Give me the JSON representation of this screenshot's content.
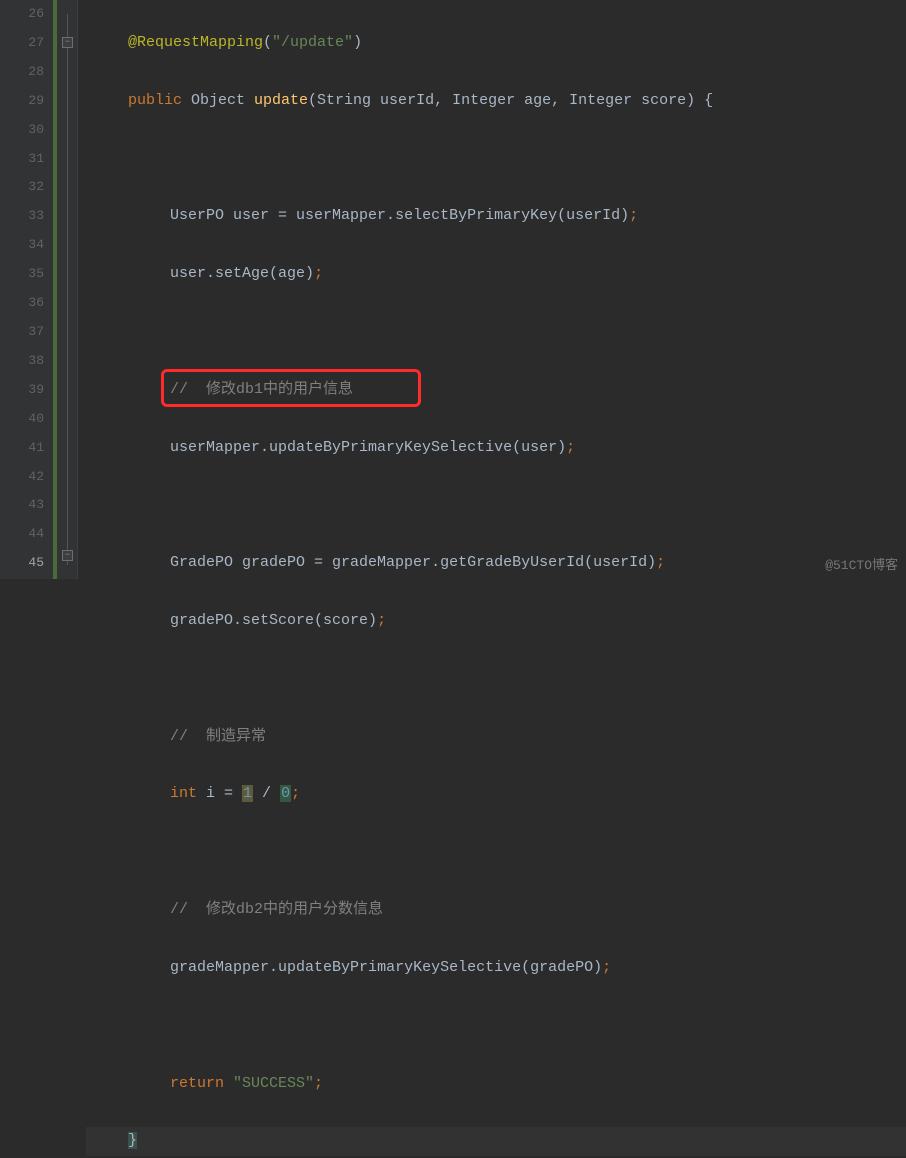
{
  "lines": {
    "26": {
      "num": "26"
    },
    "27": {
      "num": "27"
    },
    "28": {
      "num": "28"
    },
    "29": {
      "num": "29"
    },
    "30": {
      "num": "30"
    },
    "31": {
      "num": "31"
    },
    "32": {
      "num": "32"
    },
    "33": {
      "num": "33"
    },
    "34": {
      "num": "34"
    },
    "35": {
      "num": "35"
    },
    "36": {
      "num": "36"
    },
    "37": {
      "num": "37"
    },
    "38": {
      "num": "38"
    },
    "39": {
      "num": "39"
    },
    "40": {
      "num": "40"
    },
    "41": {
      "num": "41"
    },
    "42": {
      "num": "42"
    },
    "43": {
      "num": "43"
    },
    "44": {
      "num": "44"
    },
    "45": {
      "num": "45"
    }
  },
  "code": {
    "l26_annotation": "@RequestMapping",
    "l26_paren_open": "(",
    "l26_string": "\"/update\"",
    "l26_paren_close": ")",
    "l27_public": "public",
    "l27_Object": " Object ",
    "l27_update": "update",
    "l27_params": "(String userId, Integer age, Integer score) ",
    "l27_brace": "{",
    "l29_decl": "UserPO user = ",
    "l29_mapper": "userMapper",
    "l29_dot": ".",
    "l29_method": "selectByPrimaryKey",
    "l29_args": "(userId)",
    "l29_semi": ";",
    "l30_obj": "user",
    "l30_dot": ".",
    "l30_method": "setAge",
    "l30_args": "(age)",
    "l30_semi": ";",
    "l32_comment": "//  修改db1中的用户信息",
    "l33_obj": "userMapper",
    "l33_dot": ".",
    "l33_method": "updateByPrimaryKeySelective",
    "l33_args": "(user)",
    "l33_semi": ";",
    "l35_decl": "GradePO gradePO = ",
    "l35_mapper": "gradeMapper",
    "l35_dot": ".",
    "l35_method": "getGradeByUserId",
    "l35_args": "(userId)",
    "l35_semi": ";",
    "l36_obj": "gradePO",
    "l36_dot": ".",
    "l36_method": "setScore",
    "l36_args": "(score)",
    "l36_semi": ";",
    "l38_comment": "//  制造异常",
    "l39_int": "int",
    "l39_var": " i = ",
    "l39_num1": "1",
    "l39_div": " / ",
    "l39_num0": "0",
    "l39_semi": ";",
    "l41_comment": "//  修改db2中的用户分数信息",
    "l42_obj": "gradeMapper",
    "l42_dot": ".",
    "l42_method": "updateByPrimaryKeySelective",
    "l42_args": "(gradePO)",
    "l42_semi": ";",
    "l44_return": "return",
    "l44_sp": " ",
    "l44_string": "\"SUCCESS\"",
    "l44_semi": ";",
    "l45_brace": "}"
  },
  "watermark": "@51CTO博客"
}
